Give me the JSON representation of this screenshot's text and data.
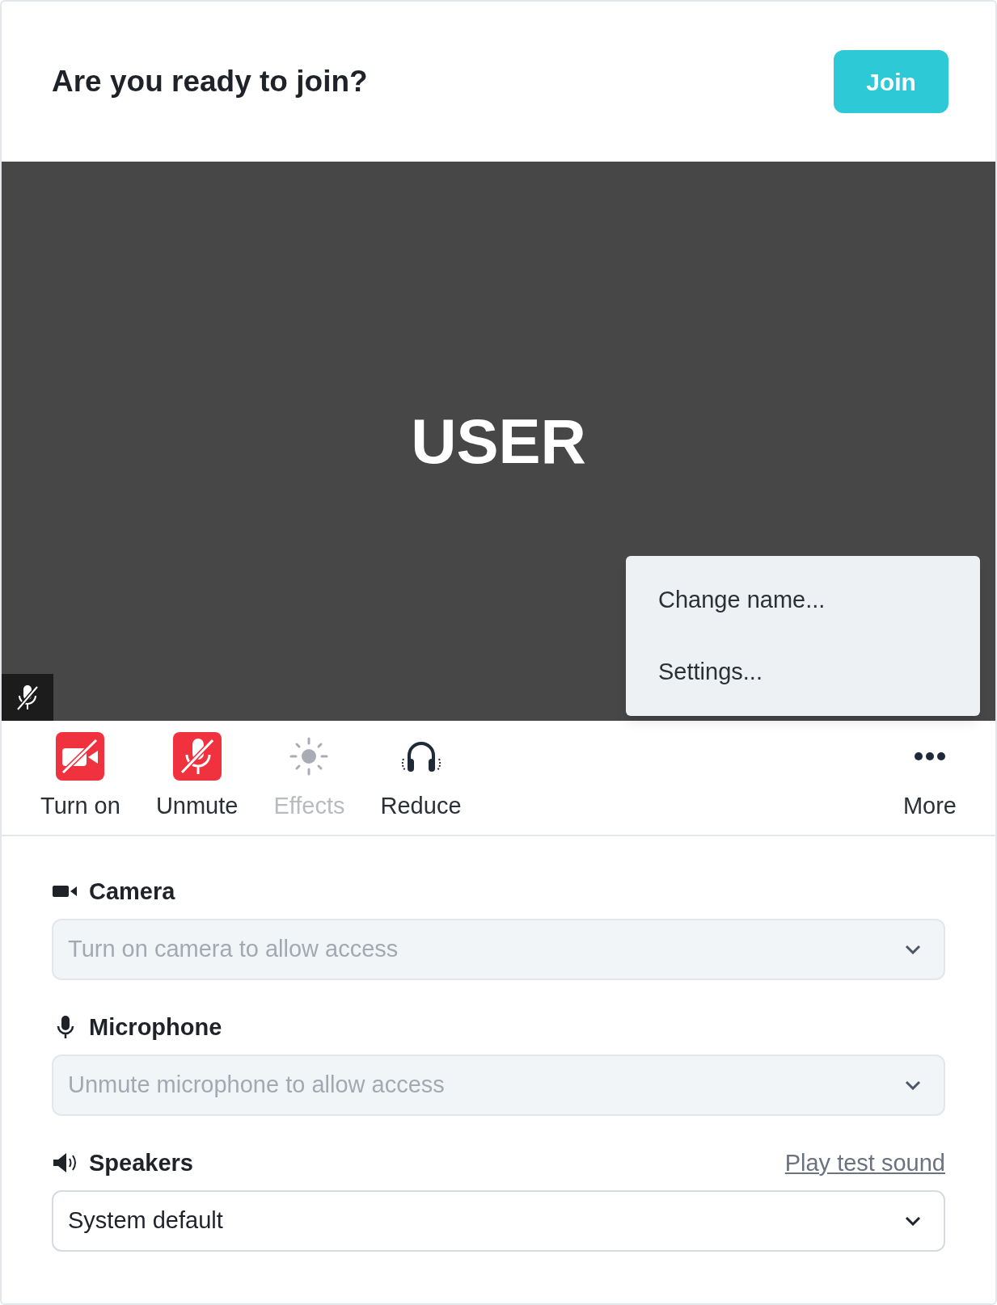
{
  "header": {
    "title": "Are you ready to join?",
    "join_button": "Join"
  },
  "preview": {
    "name": "USER",
    "mic_muted": true
  },
  "menu": {
    "items": [
      {
        "label": "Change name..."
      },
      {
        "label": "Settings..."
      }
    ]
  },
  "toolbar": [
    {
      "kind": "camera",
      "label": "Turn on",
      "off": true,
      "disabled": false
    },
    {
      "kind": "microphone",
      "label": "Unmute",
      "off": true,
      "disabled": false
    },
    {
      "kind": "effects",
      "label": "Effects",
      "off": false,
      "disabled": true
    },
    {
      "kind": "headphones",
      "label": "Reduce",
      "off": false,
      "disabled": false
    },
    {
      "kind": "more",
      "label": "More",
      "off": false,
      "disabled": false
    }
  ],
  "devices": [
    {
      "kind": "camera",
      "label": "Camera",
      "placeholder": "Turn on camera to allow access",
      "disabled": true
    },
    {
      "kind": "microphone",
      "label": "Microphone",
      "placeholder": "Unmute microphone to allow access",
      "disabled": true
    },
    {
      "kind": "speakers",
      "label": "Speakers",
      "value": "System default",
      "disabled": false,
      "link": "Play test sound"
    }
  ]
}
